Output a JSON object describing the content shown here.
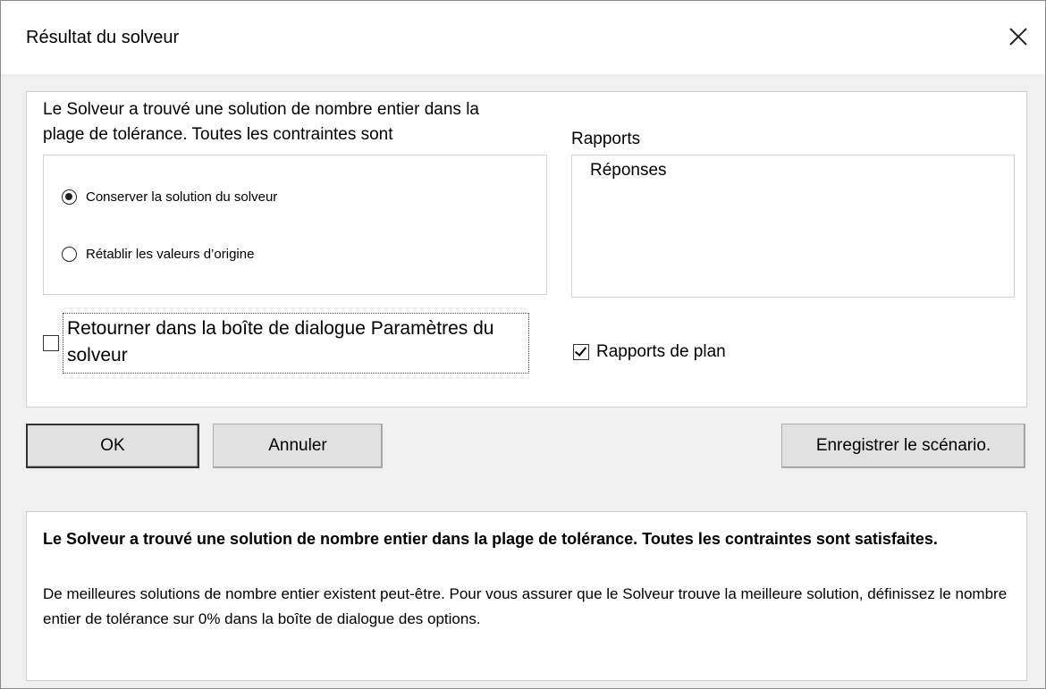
{
  "window": {
    "title": "Résultat du solveur",
    "close_label": "close"
  },
  "message": "Le Solveur a trouvé une solution de nombre entier dans la\nplage de tolérance. Toutes les contraintes sont",
  "options": {
    "keep": "Conserver la solution du solveur",
    "restore": "Rétablir les valeurs d’origine",
    "selected": "keep"
  },
  "reports": {
    "label": "Rapports",
    "items": [
      "Réponses"
    ]
  },
  "return_checkbox": {
    "label": "Retourner dans la boîte de dialogue Paramètres du solveur",
    "checked": false
  },
  "plan_checkbox": {
    "label": "Rapports de plan",
    "checked": true
  },
  "buttons": {
    "ok": "OK",
    "cancel": "Annuler",
    "save": "Enregistrer le scénario."
  },
  "info": {
    "bold": "Le Solveur a trouvé une solution de nombre entier dans la plage de tolérance. Toutes les contraintes sont satisfaites.",
    "text": "De meilleures solutions de nombre entier existent peut-être. Pour vous assurer que le Solveur trouve la meilleure solution, définissez le nombre entier de tolérance sur 0% dans la boîte de dialogue des options."
  }
}
